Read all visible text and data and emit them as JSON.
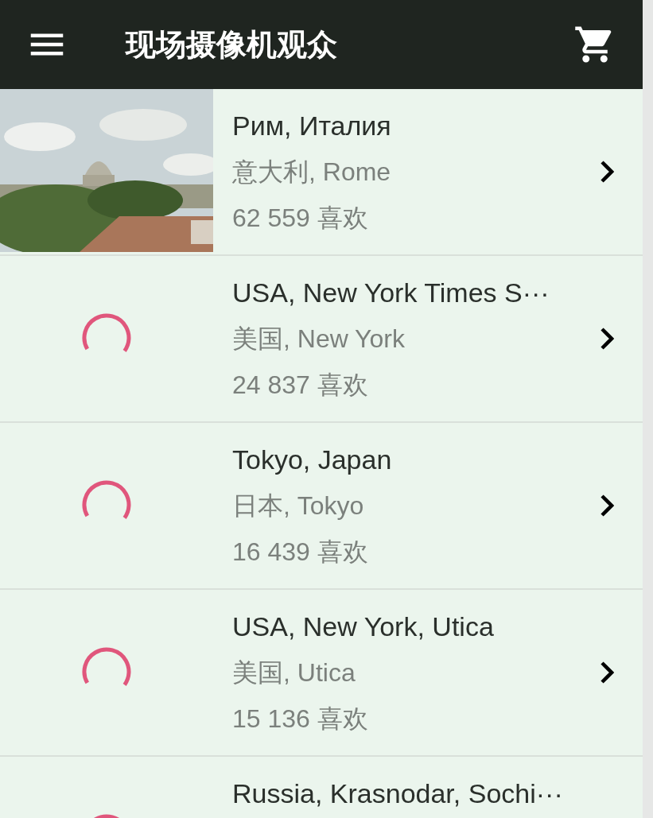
{
  "header": {
    "title": "现场摄像机观众"
  },
  "cameras": [
    {
      "kind": "picture",
      "title": "Рим, Италия",
      "subtitle": "意大利, Rome",
      "likes": "62 559 喜欢"
    },
    {
      "kind": "loading",
      "title": "USA, New York Times S···",
      "subtitle": "美国, New York",
      "likes": "24 837 喜欢"
    },
    {
      "kind": "loading",
      "title": "Tokyo, Japan",
      "subtitle": "日本, Tokyo",
      "likes": "16 439 喜欢"
    },
    {
      "kind": "loading",
      "title": "USA, New York, Utica",
      "subtitle": "美国, Utica",
      "likes": "15 136 喜欢"
    },
    {
      "kind": "loading",
      "title": "Russia, Krasnodar, Sochi···"
    }
  ]
}
